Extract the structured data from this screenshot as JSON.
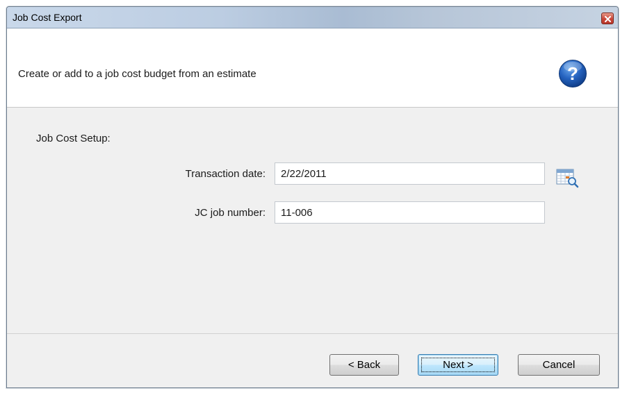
{
  "window": {
    "title": "Job Cost Export"
  },
  "header": {
    "description": "Create or add to a job cost budget from an estimate"
  },
  "setup": {
    "section_label": "Job Cost Setup:",
    "transaction_date_label": "Transaction date:",
    "transaction_date_value": "2/22/2011",
    "job_number_label": "JC job number:",
    "job_number_value": "11-006"
  },
  "footer": {
    "back_label": "< Back",
    "next_label": "Next >",
    "cancel_label": "Cancel"
  },
  "icons": {
    "close": "close-icon",
    "help": "help-icon",
    "calendar": "calendar-icon"
  },
  "colors": {
    "help_blue": "#1f5fb8",
    "close_red": "#c9473a",
    "default_button_border": "#3c7fb1"
  }
}
